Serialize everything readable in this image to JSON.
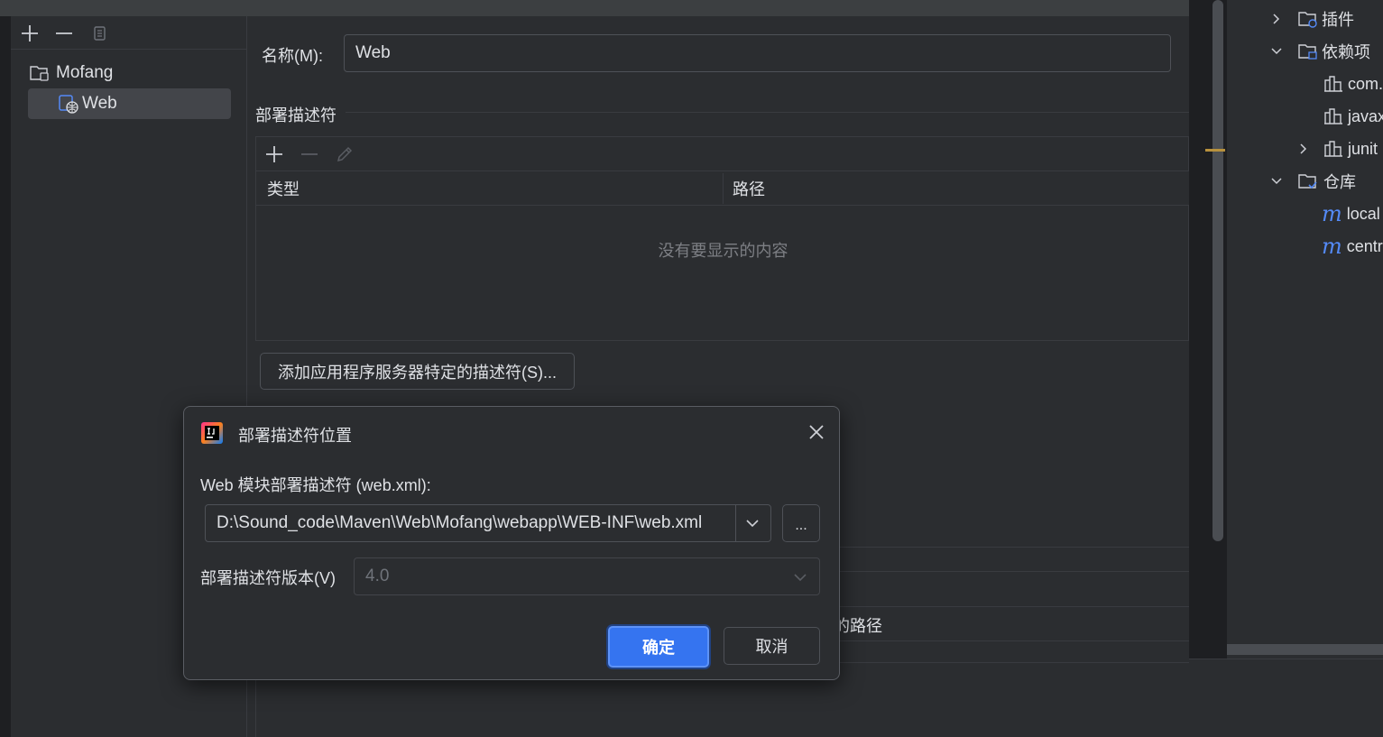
{
  "tree": {
    "items": [
      {
        "label": "Mofang"
      },
      {
        "label": "Web"
      }
    ]
  },
  "form": {
    "name_label": "名称(M):",
    "name_value": "Web",
    "section_title": "部署描述符",
    "table": {
      "col_type": "类型",
      "col_path": "路径",
      "empty_text": "没有要显示的内容"
    },
    "add_server_button": "添加应用程序服务器特定的描述符(S)...",
    "partial_path_text": "的路径"
  },
  "project": {
    "items": [
      {
        "label": "插件"
      },
      {
        "label": "依赖项"
      },
      {
        "label": "com."
      },
      {
        "label": "javax"
      },
      {
        "label": "junit"
      },
      {
        "label": "仓库"
      },
      {
        "label": "local"
      },
      {
        "label": "centr"
      }
    ]
  },
  "dialog": {
    "title": "部署描述符位置",
    "descriptor_label": "Web 模块部署描述符 (web.xml):",
    "descriptor_path": "D:\\Sound_code\\Maven\\Web\\Mofang\\webapp\\WEB-INF\\web.xml",
    "browse_label": "...",
    "version_label": "部署描述符版本(V)",
    "version_value": "4.0",
    "ok_label": "确定",
    "cancel_label": "取消"
  },
  "colors": {
    "accent": "#3574f0",
    "background": "#2b2d30",
    "marker": "#b8913d"
  }
}
